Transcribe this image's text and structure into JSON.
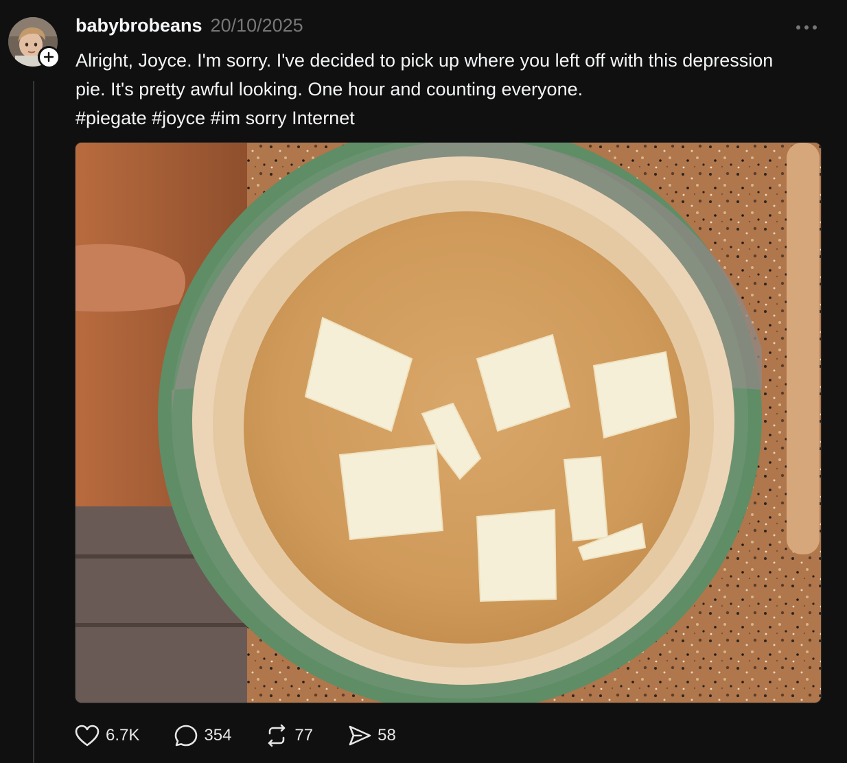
{
  "post": {
    "username": "babybrobeans",
    "date": "20/10/2025",
    "caption_text": "Alright, Joyce. I'm sorry. I've decided to pick up where you left off with this depression pie. It's pretty awful looking. One hour and counting everyone.",
    "hashtags": "#piegate #joyce #im sorry Internet",
    "more_icon": "more-horizontal-icon",
    "follow_icon": "plus-icon"
  },
  "media": {
    "subject": "pie-crust-with-butter-image"
  },
  "actions": {
    "likes": "6.7K",
    "replies": "354",
    "reposts": "77",
    "shares": "58"
  }
}
